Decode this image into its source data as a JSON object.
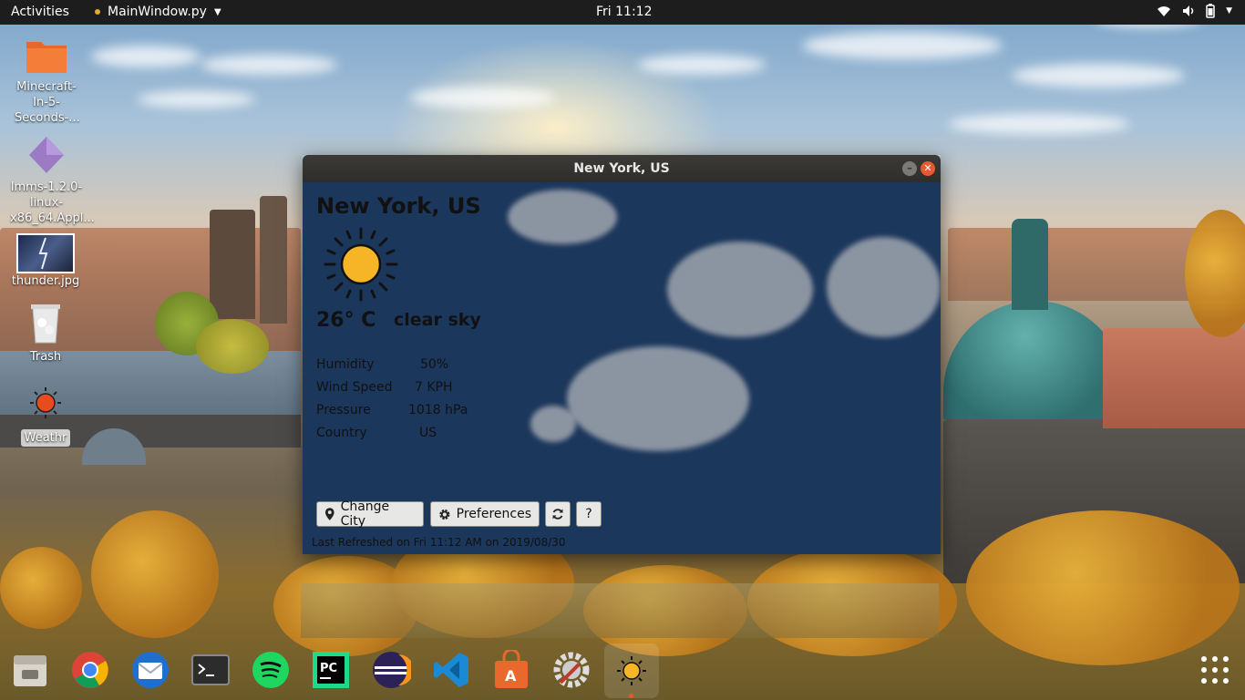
{
  "topbar": {
    "activities": "Activities",
    "app_menu": "MainWindow.py",
    "clock": "Fri 11:12"
  },
  "desktop": {
    "icons": [
      {
        "label": "Minecraft-In-5-Seconds-..."
      },
      {
        "label": "lmms-1.2.0-linux-x86_64.Appl..."
      },
      {
        "label": "thunder.jpg"
      },
      {
        "label": "Trash"
      },
      {
        "label": "Weathr"
      }
    ]
  },
  "window": {
    "title": "New York, US",
    "city": "New York, US",
    "icon": "sun-icon",
    "temperature": "26° C",
    "description": "clear sky",
    "details": [
      {
        "label": "Humidity",
        "value": "50%"
      },
      {
        "label": "Wind Speed",
        "value": "7 KPH"
      },
      {
        "label": "Pressure",
        "value": "1018 hPa"
      },
      {
        "label": "Country",
        "value": "US"
      }
    ],
    "buttons": {
      "change_city": "Change City",
      "preferences": "Preferences",
      "refresh_icon": "refresh-icon",
      "help": "?"
    },
    "last_refreshed": "Last Refreshed on Fri 11:12 AM on 2019/08/30"
  },
  "dock": {
    "apps": [
      "files",
      "chrome",
      "thunderbird",
      "terminal",
      "spotify",
      "pycharm",
      "eclipse",
      "vscode",
      "software-center",
      "settings",
      "weathr"
    ]
  },
  "colors": {
    "window_bg": "#1c375c",
    "topbar_bg": "#1d1d1d",
    "close_button": "#e9592f"
  }
}
